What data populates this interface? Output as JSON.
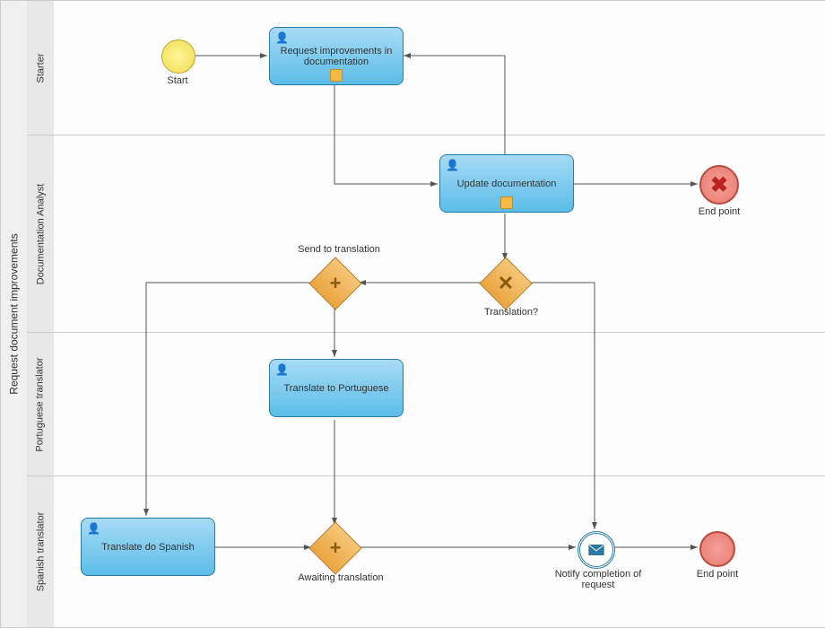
{
  "pool": {
    "title": "Request document improvements"
  },
  "lanes": {
    "starter": {
      "title": "Starter"
    },
    "analyst": {
      "title": "Documentation Analyst"
    },
    "pt": {
      "title": "Portuguese translator"
    },
    "es": {
      "title": "Spanish translator"
    }
  },
  "events": {
    "start": {
      "label": "Start"
    },
    "terminate": {
      "label": "End point"
    },
    "end": {
      "label": "End point"
    },
    "notify": {
      "label": "Notify completion of request"
    }
  },
  "tasks": {
    "request_improvements": {
      "label": "Request improvements in documentation"
    },
    "update_doc": {
      "label": "Update documentation"
    },
    "translate_pt": {
      "label": "Translate to Portuguese"
    },
    "translate_es": {
      "label": "Translate do Spanish"
    }
  },
  "gateways": {
    "translation_q": {
      "label": "Translation?"
    },
    "send_translation": {
      "label": "Send to translation"
    },
    "await_translation": {
      "label": "Awaiting translation"
    }
  }
}
